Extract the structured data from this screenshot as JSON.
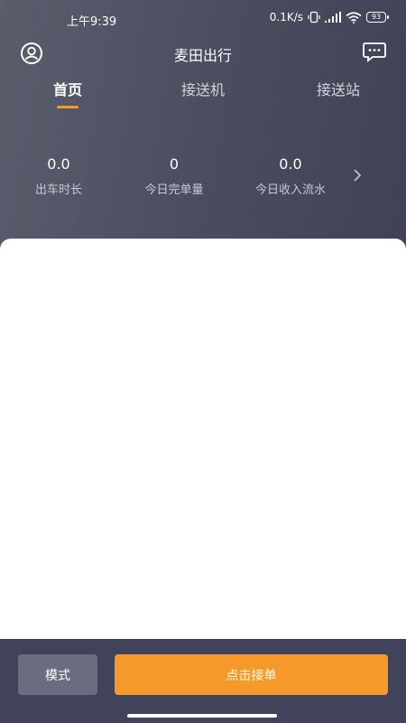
{
  "status_bar": {
    "time": "上午9:39",
    "network_speed": "0.1K/s",
    "battery": "93"
  },
  "header": {
    "title": "麦田出行",
    "left_icon": "user-icon",
    "right_icon": "message-icon"
  },
  "tabs": [
    {
      "label": "首页",
      "active": true
    },
    {
      "label": "接送机",
      "active": false
    },
    {
      "label": "接送站",
      "active": false
    }
  ],
  "stats": [
    {
      "value": "0.0",
      "label": "出车时长"
    },
    {
      "value": "0",
      "label": "今日完单量"
    },
    {
      "value": "0.0",
      "label": "今日收入流水"
    }
  ],
  "bottom": {
    "mode_label": "模式",
    "accept_label": "点击接单"
  },
  "colors": {
    "accent": "#f59a2a",
    "header_bg": "#44485a",
    "mode_button_bg": "#6a6d80"
  }
}
